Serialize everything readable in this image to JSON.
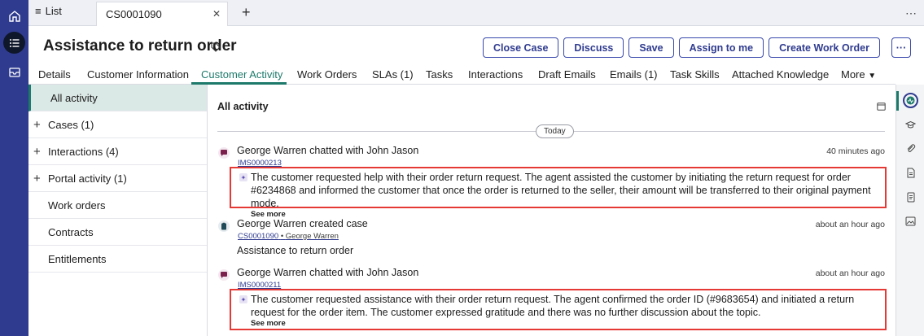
{
  "tabs": {
    "list_label": "List",
    "record_label": "CS0001090"
  },
  "header": {
    "title": "Assistance to return order",
    "actions": [
      "Close Case",
      "Discuss",
      "Save",
      "Assign to me",
      "Create Work Order"
    ],
    "more_label": "···"
  },
  "nav": {
    "items": [
      "Details",
      "Customer Information",
      "Customer Activity",
      "Work Orders",
      "SLAs (1)",
      "Tasks",
      "Interactions",
      "Draft Emails",
      "Emails (1)",
      "Task Skills",
      "Attached Knowledge",
      "More"
    ],
    "active": "Customer Activity"
  },
  "sidebar": {
    "items": [
      {
        "label": "All activity"
      },
      {
        "label": "Cases (1)"
      },
      {
        "label": "Interactions (4)"
      },
      {
        "label": "Portal activity (1)"
      },
      {
        "label": "Work orders"
      },
      {
        "label": "Contracts"
      },
      {
        "label": "Entitlements"
      }
    ]
  },
  "main": {
    "title": "All activity",
    "today_label": "Today",
    "entries": [
      {
        "headline": "George Warren chatted with John Jason",
        "time": "40 minutes ago",
        "id": "IMS0000213",
        "summary": "The customer requested help with their order return request. The agent assisted the customer by initiating the return request for order #6234868 and informed the customer that once the order is returned to the seller, their amount will be transferred to their original payment mode.",
        "see_more": "See more"
      },
      {
        "headline": "George Warren created case",
        "time": "about an hour ago",
        "id": "CS0001090",
        "meta": "George Warren",
        "case_title": "Assistance to return order"
      },
      {
        "headline": "George Warren chatted with John Jason",
        "time": "about an hour ago",
        "id": "IMS0000211",
        "summary": "The customer requested assistance with their order return request. The agent confirmed the order ID (#9683654) and initiated a return request for the order item. The customer expressed gratitude and there was no further discussion about the topic.",
        "see_more": "See more"
      }
    ]
  },
  "colors": {
    "rail": "#2f3b8f",
    "accent": "#1d7a6b",
    "highlight": "#e53935",
    "button": "#3949ab"
  },
  "icons": [
    "home-icon",
    "list-icon",
    "inbox-icon",
    "tag-icon",
    "calendar-icon",
    "chat-icon",
    "case-icon",
    "ai-summary-icon",
    "graduation-cap-icon",
    "paperclip-icon",
    "document-icon",
    "notes-icon",
    "image-icon",
    "activity-icon"
  ]
}
